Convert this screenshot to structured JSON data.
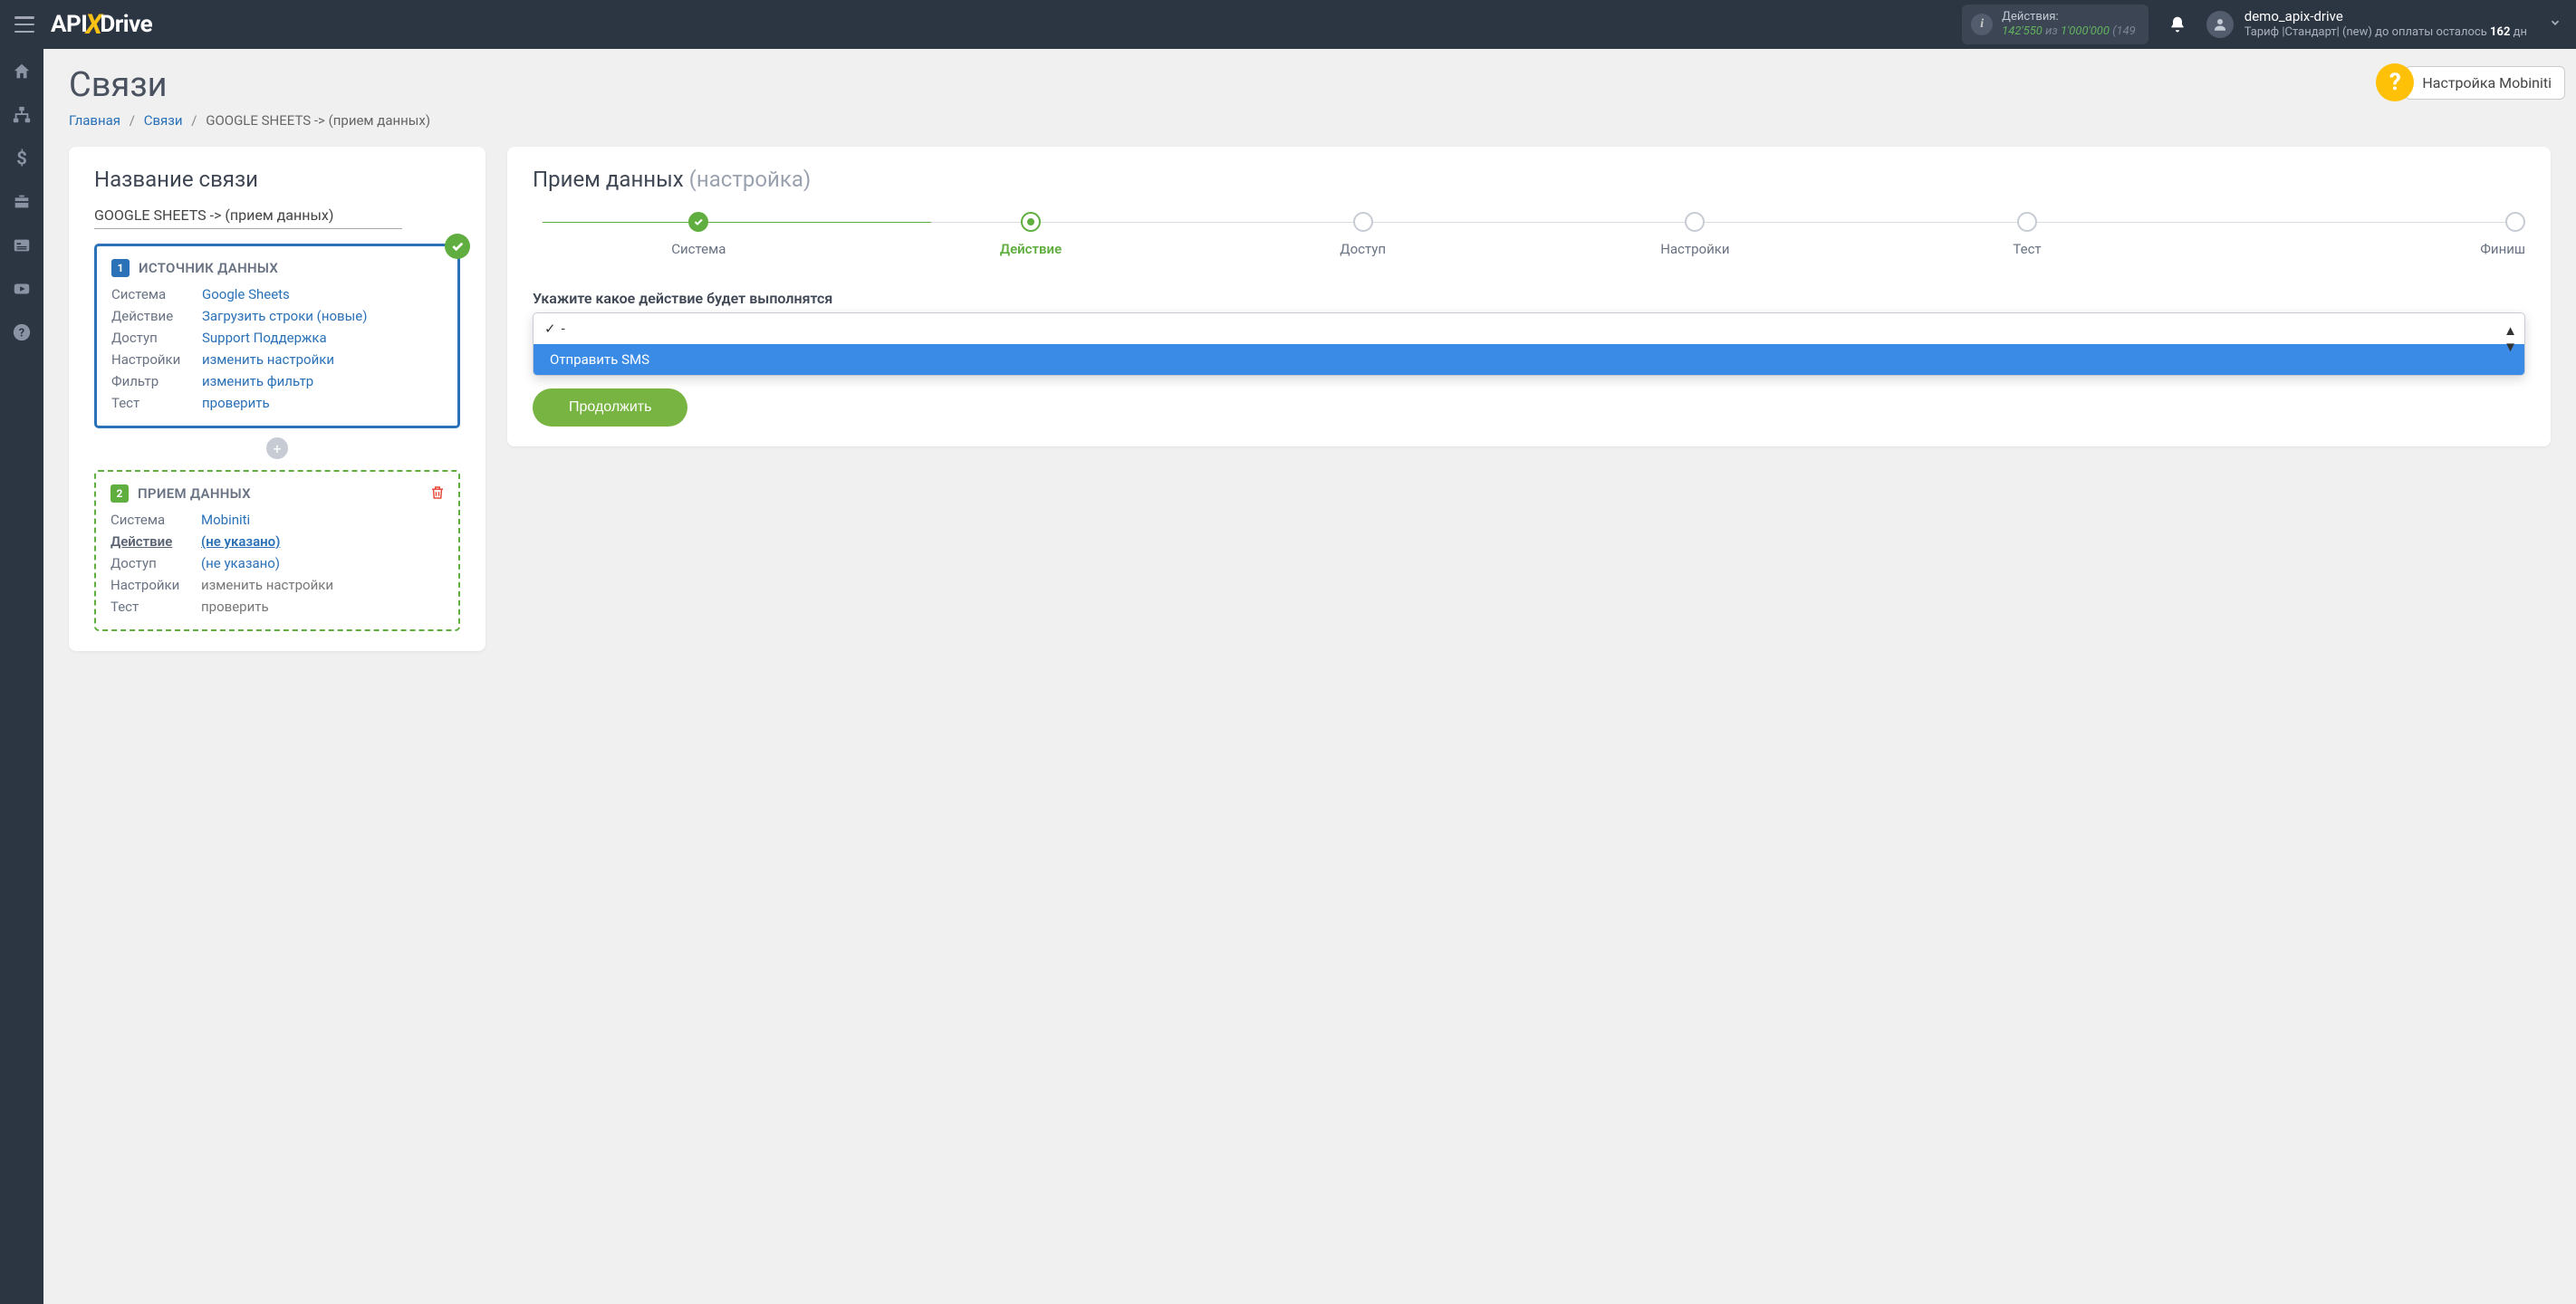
{
  "header": {
    "actions_label": "Действия:",
    "actions_used": "142'550",
    "actions_of": "из",
    "actions_total": "1'000'000",
    "actions_tail": "(149",
    "user_name": "demo_apix-drive",
    "plan_prefix": "Тариф |Стандарт| (new) до оплаты осталось",
    "plan_days": "162",
    "plan_suffix": "дн"
  },
  "help": {
    "label": "Настройка Mobiniti"
  },
  "page": {
    "title": "Связи"
  },
  "breadcrumbs": {
    "home": "Главная",
    "links": "Связи",
    "current": "GOOGLE SHEETS -> (прием данных)"
  },
  "leftPanel": {
    "title": "Название связи",
    "name_value": "GOOGLE SHEETS -> (прием данных)",
    "source": {
      "num": "1",
      "title": "ИСТОЧНИК ДАННЫХ",
      "rows": {
        "system_l": "Система",
        "system_v": "Google Sheets",
        "action_l": "Действие",
        "action_v": "Загрузить строки (новые)",
        "access_l": "Доступ",
        "access_v": "Support Поддержка",
        "settings_l": "Настройки",
        "settings_v": "изменить настройки",
        "filter_l": "Фильтр",
        "filter_v": "изменить фильтр",
        "test_l": "Тест",
        "test_v": "проверить"
      }
    },
    "dest": {
      "num": "2",
      "title": "ПРИЕМ ДАННЫХ",
      "rows": {
        "system_l": "Система",
        "system_v": "Mobiniti",
        "action_l": "Действие",
        "action_v": "(не указано)",
        "access_l": "Доступ",
        "access_v": "(не указано)",
        "settings_l": "Настройки",
        "settings_v": "изменить настройки",
        "test_l": "Тест",
        "test_v": "проверить"
      }
    }
  },
  "rightPanel": {
    "title_main": "Прием данных",
    "title_sub": "(настройка)",
    "steps": {
      "s1": "Система",
      "s2": "Действие",
      "s3": "Доступ",
      "s4": "Настройки",
      "s5": "Тест",
      "s6": "Финиш"
    },
    "prompt": "Укажите какое действие будет выполнятся",
    "dropdown": {
      "selected": "-",
      "option1": "Отправить SMS"
    },
    "continue": "Продолжить"
  }
}
